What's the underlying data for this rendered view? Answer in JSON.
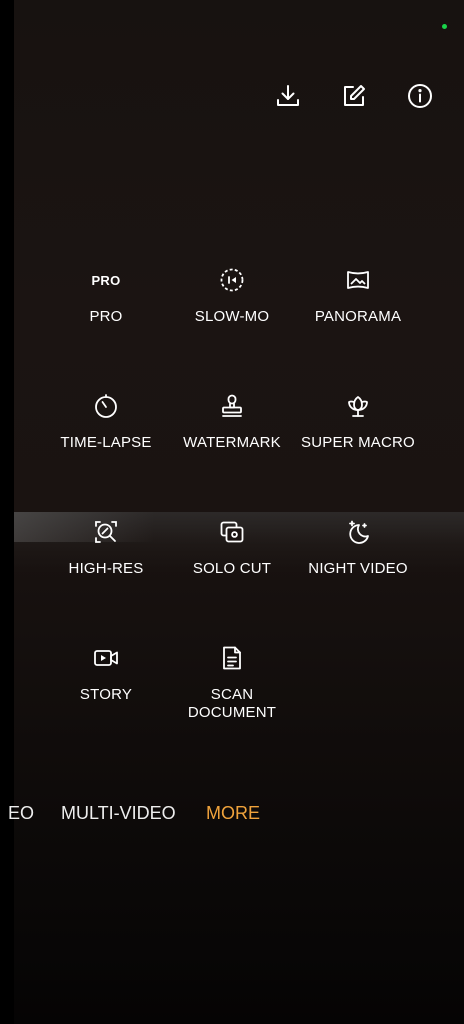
{
  "colors": {
    "accent": "#f0a33c",
    "status_dot": "#19d44a",
    "text": "#ffffff"
  },
  "toolbar": {
    "download_icon": "download-icon",
    "edit_icon": "edit-icon",
    "info_icon": "info-icon"
  },
  "modes": [
    {
      "label": "PRO",
      "icon": "pro-icon",
      "icon_text": "PRO"
    },
    {
      "label": "SLOW-MO",
      "icon": "slow-mo-icon"
    },
    {
      "label": "PANORAMA",
      "icon": "panorama-icon"
    },
    {
      "label": "TIME-LAPSE",
      "icon": "time-lapse-icon"
    },
    {
      "label": "WATERMARK",
      "icon": "watermark-icon"
    },
    {
      "label": "SUPER MACRO",
      "icon": "super-macro-icon"
    },
    {
      "label": "HIGH-RES",
      "icon": "high-res-icon"
    },
    {
      "label": "SOLO CUT",
      "icon": "solo-cut-icon"
    },
    {
      "label": "NIGHT VIDEO",
      "icon": "night-video-icon"
    },
    {
      "label": "STORY",
      "icon": "story-icon"
    },
    {
      "label": "SCAN\nDOCUMENT",
      "label_line1": "SCAN",
      "label_line2": "DOCUMENT",
      "icon": "scan-document-icon"
    }
  ],
  "tabs": [
    {
      "label": "EO"
    },
    {
      "label": "MULTI-VIDEO"
    },
    {
      "label": "MORE",
      "active": true
    }
  ]
}
